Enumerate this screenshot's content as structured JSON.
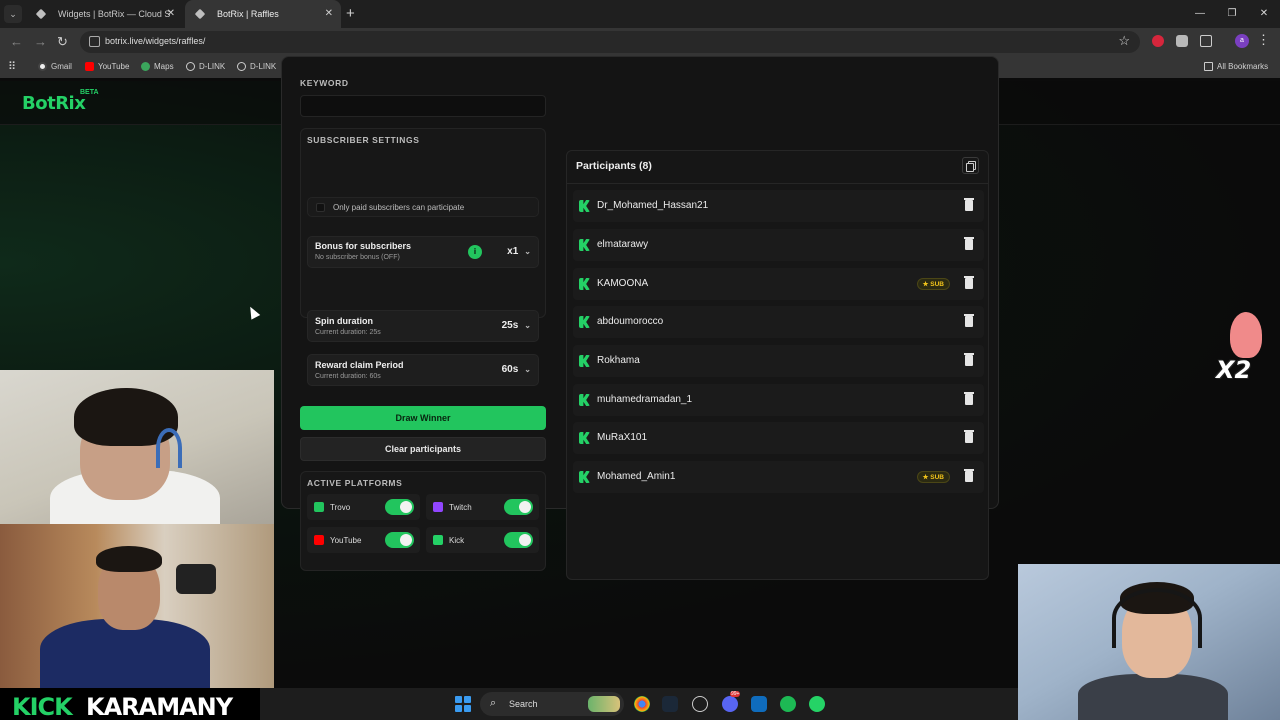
{
  "browser": {
    "tabs": [
      {
        "title": "Widgets | BotRix — Cloud Stream",
        "active": false
      },
      {
        "title": "BotRix | Raffles",
        "active": true
      }
    ],
    "url": "botrix.live/widgets/raffles/",
    "bookmarks": [
      "Gmail",
      "YouTube",
      "Maps",
      "D-LINK",
      "D-LINK"
    ],
    "all_bookmarks": "All Bookmarks",
    "profile_initial": "a"
  },
  "site": {
    "logo": "BotRix",
    "badge": "BETA"
  },
  "settings": {
    "keyword_label": "KEYWORD",
    "keyword_value": "",
    "subscriber_title": "SUBSCRIBER SETTINGS",
    "bonus": {
      "title": "Bonus for subscribers",
      "subtitle": "No subscriber bonus (OFF)",
      "value": "x1"
    },
    "only_paid_label": "Only paid subscribers can participate",
    "only_paid_checked": false,
    "spin": {
      "title": "Spin duration",
      "subtitle": "Current duration: 25s",
      "value": "25s"
    },
    "claim": {
      "title": "Reward claim Period",
      "subtitle": "Current duration: 60s",
      "value": "60s"
    },
    "draw_label": "Draw Winner",
    "clear_label": "Clear participants",
    "platforms_title": "ACTIVE PLATFORMS",
    "platforms": [
      {
        "name": "Trovo",
        "enabled": true,
        "color": "#22c55e"
      },
      {
        "name": "Twitch",
        "enabled": true,
        "color": "#9146ff"
      },
      {
        "name": "YouTube",
        "enabled": true,
        "color": "#ff0000"
      },
      {
        "name": "Kick",
        "enabled": true,
        "color": "#24d166"
      }
    ]
  },
  "participants": {
    "title": "Participants (8)",
    "list": [
      {
        "name": "Dr_Mohamed_Hassan21",
        "sub": false
      },
      {
        "name": "elmatarawy",
        "sub": false
      },
      {
        "name": "KAMOONA",
        "sub": true
      },
      {
        "name": "abdoumorocco",
        "sub": false
      },
      {
        "name": "Rokhama",
        "sub": false
      },
      {
        "name": "muhamedramadan_1",
        "sub": false
      },
      {
        "name": "MuRaX101",
        "sub": false
      },
      {
        "name": "Mohamed_Amin1",
        "sub": true
      }
    ],
    "sub_badge": "★ SUB"
  },
  "overlay": {
    "sticker_text": "X2",
    "banner_kick": "KICK",
    "banner_name": "KARAMANY"
  },
  "taskbar": {
    "search_label": "Search",
    "mail_badge": "99+"
  },
  "colors": {
    "accent": "#22c55e",
    "sub_badge": "#f1c31b"
  }
}
